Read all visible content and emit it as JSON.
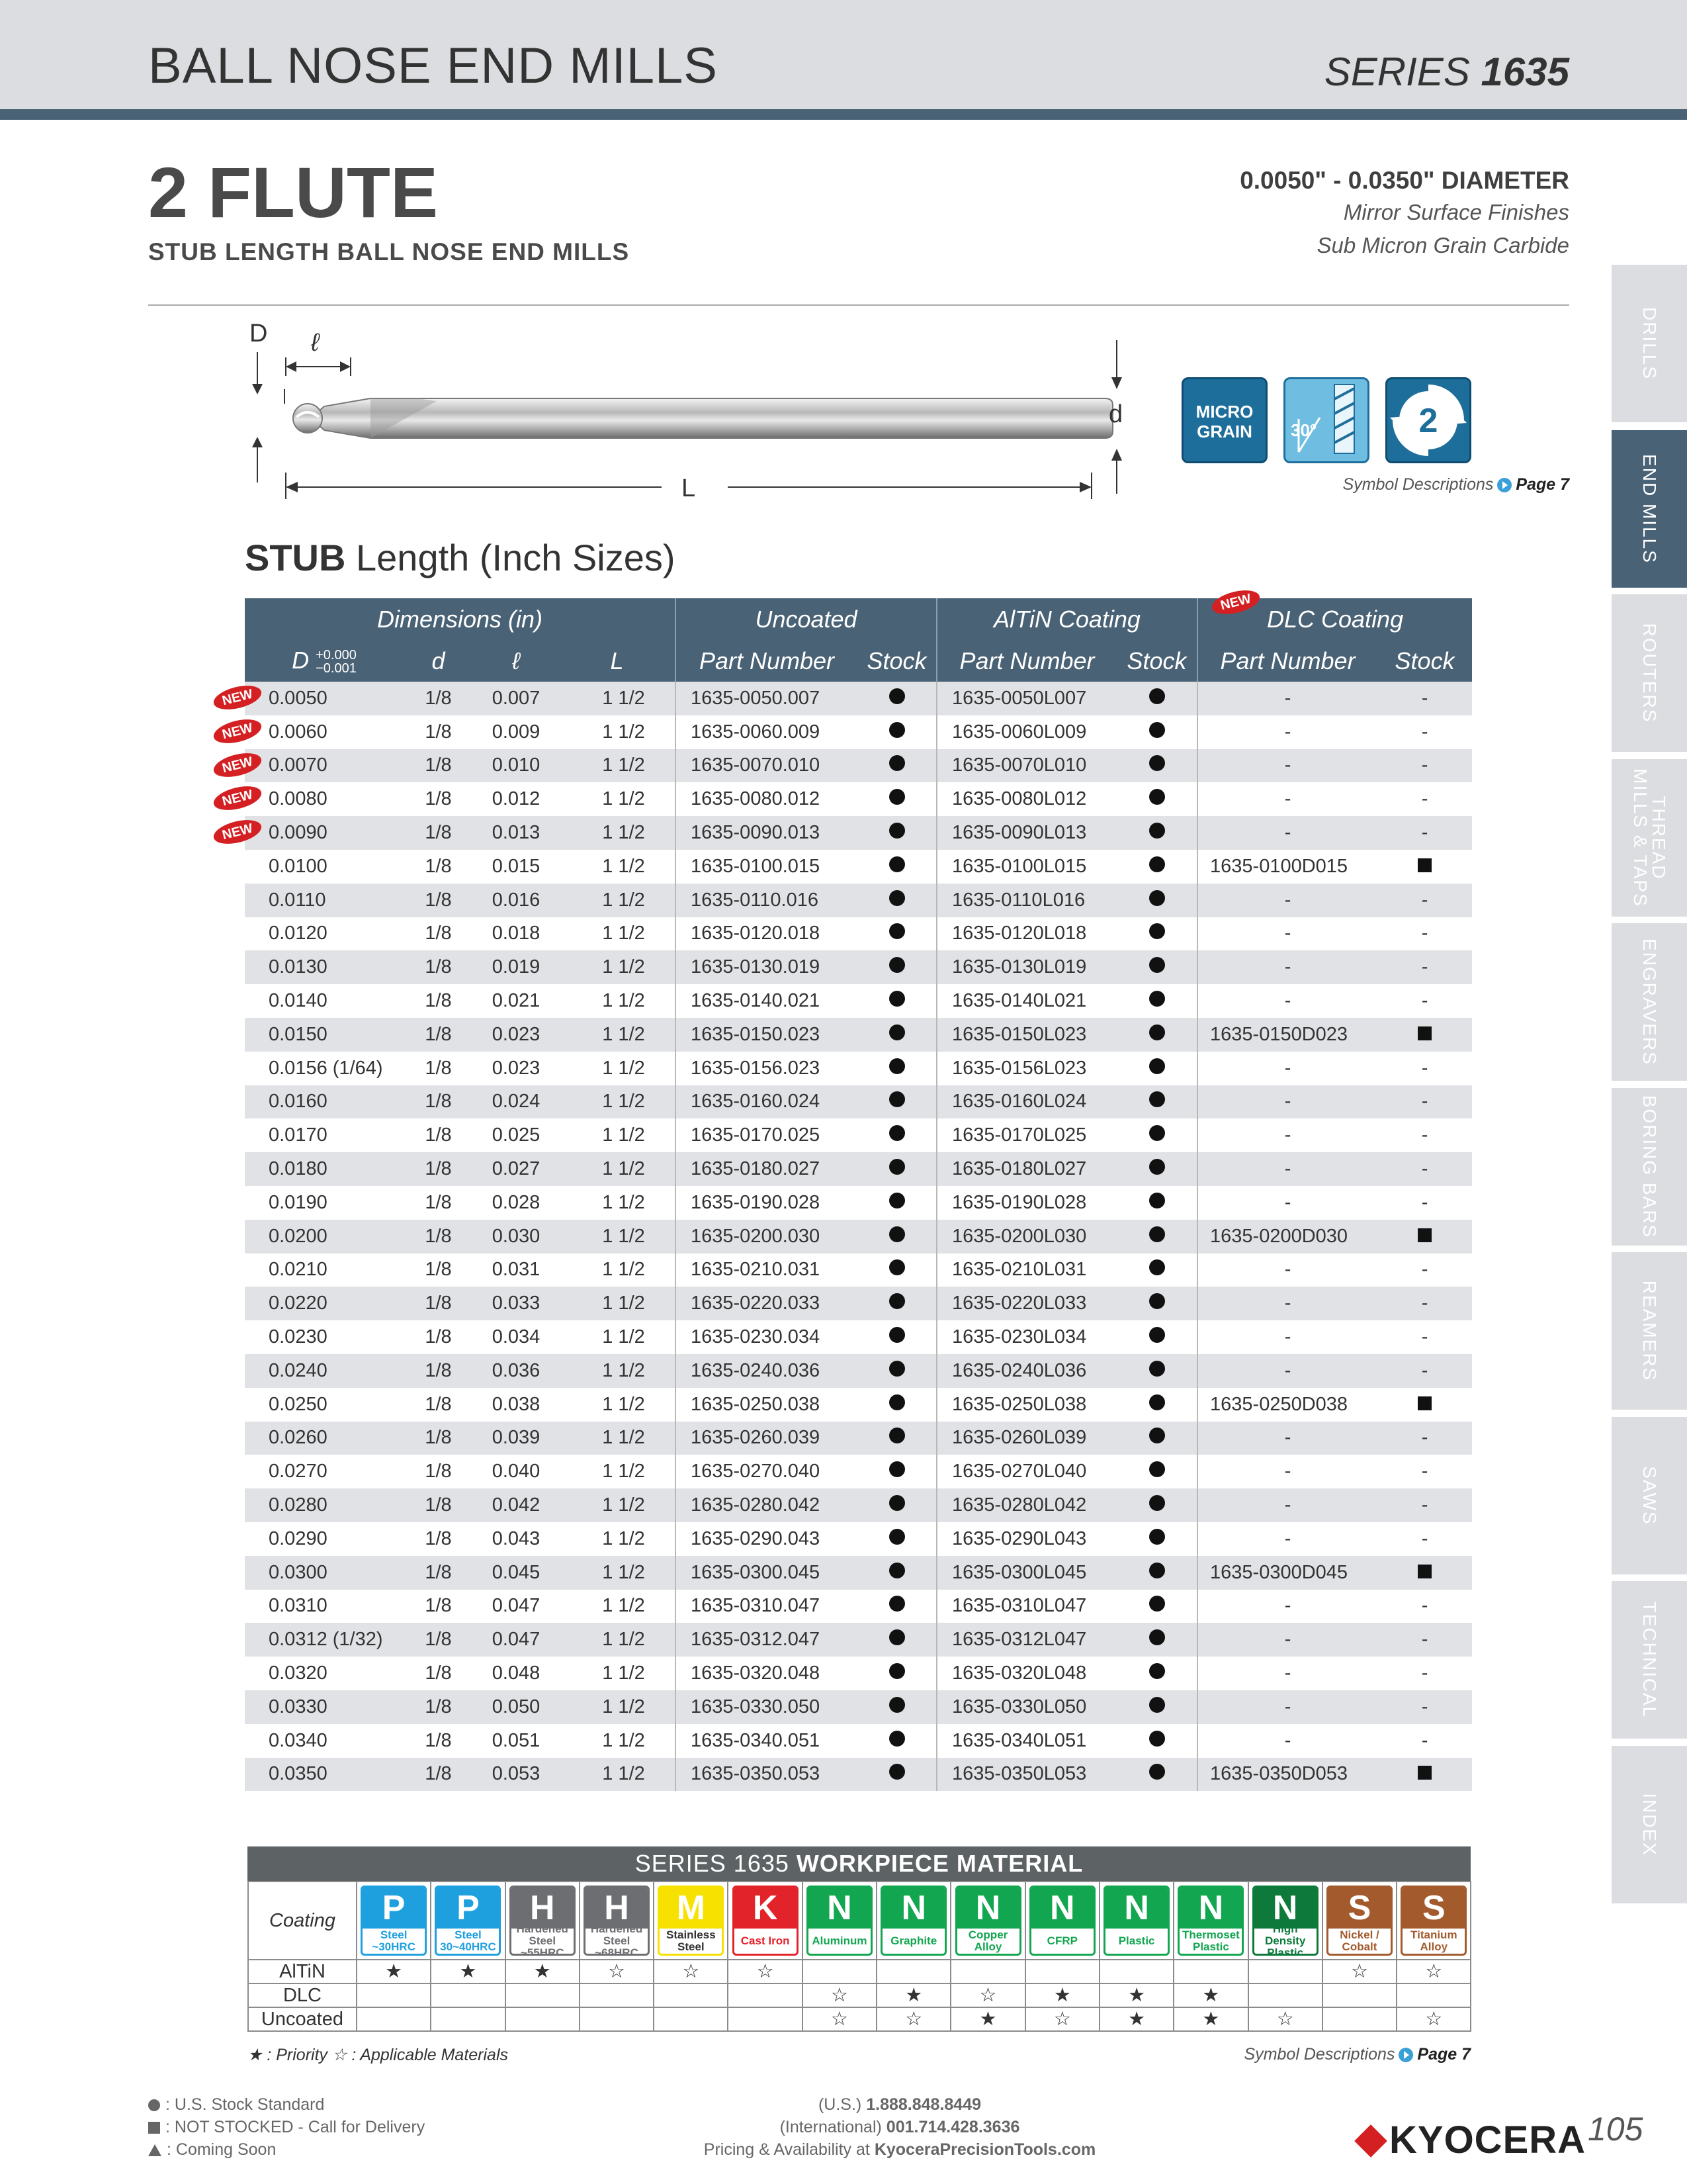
{
  "header": {
    "title": "BALL NOSE END MILLS",
    "series_label": "SERIES",
    "series_number": "1635"
  },
  "product": {
    "flutes": "2 FLUTE",
    "subtitle": "STUB LENGTH BALL NOSE END MILLS",
    "diameter_range": "0.0050\" - 0.0350\" DIAMETER",
    "feature1": "Mirror Surface Finishes",
    "feature2": "Sub Micron Grain Carbide"
  },
  "diagram": {
    "D": "D",
    "l": "ℓ",
    "d": "d",
    "L": "L"
  },
  "icons": {
    "micro_line1": "MICRO",
    "micro_line2": "GRAIN",
    "helix": "30°",
    "flute_count": "2",
    "micro_icon": "micro-grain-icon",
    "helix_icon": "helix-30-icon",
    "flute_icon": "two-flute-icon"
  },
  "symbol_desc": {
    "text": "Symbol Descriptions",
    "page": "Page 7"
  },
  "section": {
    "bold": "STUB",
    "rest": " Length (Inch Sizes)"
  },
  "side_tabs": [
    {
      "label": "DRILLS",
      "active": false
    },
    {
      "label": "END MILLS",
      "active": true
    },
    {
      "label": "ROUTERS",
      "active": false
    },
    {
      "label": "THREAD MILLS & TAPS",
      "active": false
    },
    {
      "label": "ENGRAVERS",
      "active": false
    },
    {
      "label": "BORING BARS",
      "active": false
    },
    {
      "label": "REAMERS",
      "active": false
    },
    {
      "label": "SAWS",
      "active": false
    },
    {
      "label": "TECHNICAL",
      "active": false
    },
    {
      "label": "INDEX",
      "active": false
    }
  ],
  "table": {
    "groups": {
      "dimensions": "Dimensions (in)",
      "uncoated": "Uncoated",
      "altin": "AlTiN Coating",
      "dlc": "DLC Coating"
    },
    "columns": {
      "D": "D",
      "tol_plus": "+0.000",
      "tol_minus": "−0.001",
      "d": "d",
      "l": "ℓ",
      "L": "L",
      "part": "Part Number",
      "stock": "Stock"
    },
    "new_label": "NEW",
    "rows": [
      {
        "D": "0.0050",
        "d": "1/8",
        "l": "0.007",
        "L": "1 1/2",
        "un": "1635-0050.007",
        "al": "1635-0050L007",
        "dlc": "-",
        "new": true
      },
      {
        "D": "0.0060",
        "d": "1/8",
        "l": "0.009",
        "L": "1 1/2",
        "un": "1635-0060.009",
        "al": "1635-0060L009",
        "dlc": "-",
        "new": true
      },
      {
        "D": "0.0070",
        "d": "1/8",
        "l": "0.010",
        "L": "1 1/2",
        "un": "1635-0070.010",
        "al": "1635-0070L010",
        "dlc": "-",
        "new": true
      },
      {
        "D": "0.0080",
        "d": "1/8",
        "l": "0.012",
        "L": "1 1/2",
        "un": "1635-0080.012",
        "al": "1635-0080L012",
        "dlc": "-",
        "new": true
      },
      {
        "D": "0.0090",
        "d": "1/8",
        "l": "0.013",
        "L": "1 1/2",
        "un": "1635-0090.013",
        "al": "1635-0090L013",
        "dlc": "-",
        "new": true
      },
      {
        "D": "0.0100",
        "d": "1/8",
        "l": "0.015",
        "L": "1 1/2",
        "un": "1635-0100.015",
        "al": "1635-0100L015",
        "dlc": "1635-0100D015"
      },
      {
        "D": "0.0110",
        "d": "1/8",
        "l": "0.016",
        "L": "1 1/2",
        "un": "1635-0110.016",
        "al": "1635-0110L016",
        "dlc": "-"
      },
      {
        "D": "0.0120",
        "d": "1/8",
        "l": "0.018",
        "L": "1 1/2",
        "un": "1635-0120.018",
        "al": "1635-0120L018",
        "dlc": "-"
      },
      {
        "D": "0.0130",
        "d": "1/8",
        "l": "0.019",
        "L": "1 1/2",
        "un": "1635-0130.019",
        "al": "1635-0130L019",
        "dlc": "-"
      },
      {
        "D": "0.0140",
        "d": "1/8",
        "l": "0.021",
        "L": "1 1/2",
        "un": "1635-0140.021",
        "al": "1635-0140L021",
        "dlc": "-"
      },
      {
        "D": "0.0150",
        "d": "1/8",
        "l": "0.023",
        "L": "1 1/2",
        "un": "1635-0150.023",
        "al": "1635-0150L023",
        "dlc": "1635-0150D023"
      },
      {
        "D": "0.0156 (1/64)",
        "d": "1/8",
        "l": "0.023",
        "L": "1 1/2",
        "un": "1635-0156.023",
        "al": "1635-0156L023",
        "dlc": "-"
      },
      {
        "D": "0.0160",
        "d": "1/8",
        "l": "0.024",
        "L": "1 1/2",
        "un": "1635-0160.024",
        "al": "1635-0160L024",
        "dlc": "-"
      },
      {
        "D": "0.0170",
        "d": "1/8",
        "l": "0.025",
        "L": "1 1/2",
        "un": "1635-0170.025",
        "al": "1635-0170L025",
        "dlc": "-"
      },
      {
        "D": "0.0180",
        "d": "1/8",
        "l": "0.027",
        "L": "1 1/2",
        "un": "1635-0180.027",
        "al": "1635-0180L027",
        "dlc": "-"
      },
      {
        "D": "0.0190",
        "d": "1/8",
        "l": "0.028",
        "L": "1 1/2",
        "un": "1635-0190.028",
        "al": "1635-0190L028",
        "dlc": "-"
      },
      {
        "D": "0.0200",
        "d": "1/8",
        "l": "0.030",
        "L": "1 1/2",
        "un": "1635-0200.030",
        "al": "1635-0200L030",
        "dlc": "1635-0200D030"
      },
      {
        "D": "0.0210",
        "d": "1/8",
        "l": "0.031",
        "L": "1 1/2",
        "un": "1635-0210.031",
        "al": "1635-0210L031",
        "dlc": "-"
      },
      {
        "D": "0.0220",
        "d": "1/8",
        "l": "0.033",
        "L": "1 1/2",
        "un": "1635-0220.033",
        "al": "1635-0220L033",
        "dlc": "-"
      },
      {
        "D": "0.0230",
        "d": "1/8",
        "l": "0.034",
        "L": "1 1/2",
        "un": "1635-0230.034",
        "al": "1635-0230L034",
        "dlc": "-"
      },
      {
        "D": "0.0240",
        "d": "1/8",
        "l": "0.036",
        "L": "1 1/2",
        "un": "1635-0240.036",
        "al": "1635-0240L036",
        "dlc": "-"
      },
      {
        "D": "0.0250",
        "d": "1/8",
        "l": "0.038",
        "L": "1 1/2",
        "un": "1635-0250.038",
        "al": "1635-0250L038",
        "dlc": "1635-0250D038"
      },
      {
        "D": "0.0260",
        "d": "1/8",
        "l": "0.039",
        "L": "1 1/2",
        "un": "1635-0260.039",
        "al": "1635-0260L039",
        "dlc": "-"
      },
      {
        "D": "0.0270",
        "d": "1/8",
        "l": "0.040",
        "L": "1 1/2",
        "un": "1635-0270.040",
        "al": "1635-0270L040",
        "dlc": "-"
      },
      {
        "D": "0.0280",
        "d": "1/8",
        "l": "0.042",
        "L": "1 1/2",
        "un": "1635-0280.042",
        "al": "1635-0280L042",
        "dlc": "-"
      },
      {
        "D": "0.0290",
        "d": "1/8",
        "l": "0.043",
        "L": "1 1/2",
        "un": "1635-0290.043",
        "al": "1635-0290L043",
        "dlc": "-"
      },
      {
        "D": "0.0300",
        "d": "1/8",
        "l": "0.045",
        "L": "1 1/2",
        "un": "1635-0300.045",
        "al": "1635-0300L045",
        "dlc": "1635-0300D045"
      },
      {
        "D": "0.0310",
        "d": "1/8",
        "l": "0.047",
        "L": "1 1/2",
        "un": "1635-0310.047",
        "al": "1635-0310L047",
        "dlc": "-"
      },
      {
        "D": "0.0312 (1/32)",
        "d": "1/8",
        "l": "0.047",
        "L": "1 1/2",
        "un": "1635-0312.047",
        "al": "1635-0312L047",
        "dlc": "-"
      },
      {
        "D": "0.0320",
        "d": "1/8",
        "l": "0.048",
        "L": "1 1/2",
        "un": "1635-0320.048",
        "al": "1635-0320L048",
        "dlc": "-"
      },
      {
        "D": "0.0330",
        "d": "1/8",
        "l": "0.050",
        "L": "1 1/2",
        "un": "1635-0330.050",
        "al": "1635-0330L050",
        "dlc": "-"
      },
      {
        "D": "0.0340",
        "d": "1/8",
        "l": "0.051",
        "L": "1 1/2",
        "un": "1635-0340.051",
        "al": "1635-0340L051",
        "dlc": "-"
      },
      {
        "D": "0.0350",
        "d": "1/8",
        "l": "0.053",
        "L": "1 1/2",
        "un": "1635-0350.053",
        "al": "1635-0350L053",
        "dlc": "1635-0350D053"
      }
    ]
  },
  "workpiece": {
    "title_series": "SERIES 1635",
    "title_bold": "WORKPIECE MATERIAL",
    "coating_label": "Coating",
    "materials": [
      {
        "letter": "P",
        "label": "Steel ~30HRC",
        "color": "#1ea0df"
      },
      {
        "letter": "P",
        "label": "Steel 30~40HRC",
        "color": "#1ea0df"
      },
      {
        "letter": "H",
        "label": "Hardened Steel ~55HRC",
        "color": "#6d6e71"
      },
      {
        "letter": "H",
        "label": "Hardened Steel ~68HRC",
        "color": "#6d6e71"
      },
      {
        "letter": "M",
        "label": "Stainless Steel",
        "color": "#f6e100"
      },
      {
        "letter": "K",
        "label": "Cast Iron",
        "color": "#e3232a"
      },
      {
        "letter": "N",
        "label": "Aluminum",
        "color": "#13a651"
      },
      {
        "letter": "N",
        "label": "Graphite",
        "color": "#13a651"
      },
      {
        "letter": "N",
        "label": "Copper Alloy",
        "color": "#13a651"
      },
      {
        "letter": "N",
        "label": "CFRP",
        "color": "#13a651"
      },
      {
        "letter": "N",
        "label": "Plastic",
        "color": "#13a651"
      },
      {
        "letter": "N",
        "label": "Thermoset Plastic",
        "color": "#13a651"
      },
      {
        "letter": "N",
        "label": "High Density Plastic",
        "color": "#0d7a3c"
      },
      {
        "letter": "S",
        "label": "Nickel / Cobalt",
        "color": "#a35a2c"
      },
      {
        "letter": "S",
        "label": "Titanium Alloy",
        "color": "#a35a2c"
      }
    ],
    "rows": [
      {
        "name": "AlTiN",
        "marks": [
          "★",
          "★",
          "★",
          "☆",
          "☆",
          "☆",
          "",
          "",
          "",
          "",
          "",
          "",
          "",
          "☆",
          "☆"
        ]
      },
      {
        "name": "DLC",
        "marks": [
          "",
          "",
          "",
          "",
          "",
          "",
          "☆",
          "★",
          "☆",
          "★",
          "★",
          "★",
          "",
          "",
          ""
        ]
      },
      {
        "name": "Uncoated",
        "marks": [
          "",
          "",
          "",
          "",
          "",
          "",
          "☆",
          "☆",
          "★",
          "☆",
          "★",
          "★",
          "☆",
          "",
          "☆"
        ]
      }
    ],
    "legend": "★ : Priority  ☆ : Applicable Materials"
  },
  "footer": {
    "stock_standard": ": U.S. Stock Standard",
    "not_stocked": ": NOT STOCKED - Call for Delivery",
    "coming_soon": ": Coming Soon",
    "us_label": "(U.S.)",
    "us_phone": "1.888.848.8449",
    "intl_label": "(International)",
    "intl_phone": "001.714.428.3636",
    "pricing": "Pricing & Availability at",
    "site": "KyoceraPrecisionTools.com",
    "brand": "KYOCERA",
    "page_number": "105"
  }
}
